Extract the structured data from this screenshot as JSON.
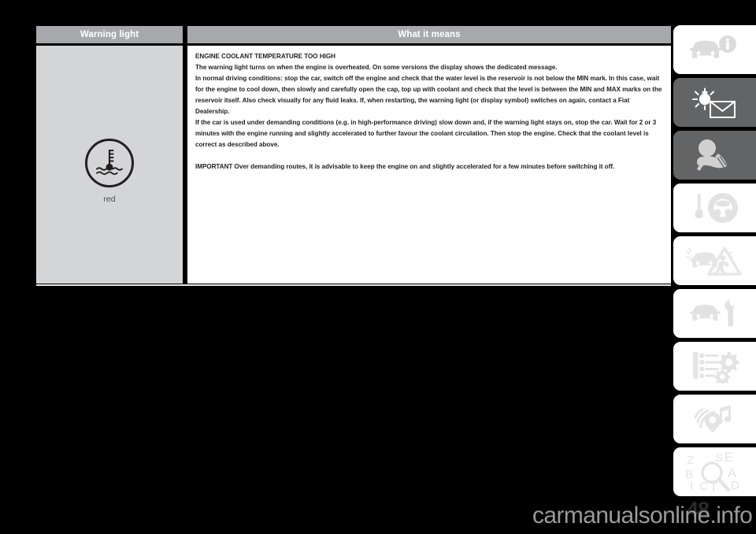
{
  "table": {
    "headers": {
      "warning_light": "Warning light",
      "what_it_means": "What it means"
    },
    "symbol": {
      "icon": "coolant-temperature-icon",
      "color_label": "red"
    },
    "content": {
      "title": "ENGINE COOLANT TEMPERATURE TOO HIGH",
      "paragraph_1": "The warning light turns on when the engine is overheated. On some versions the display shows the dedicated message.",
      "paragraph_2": "In normal driving conditions: stop the car, switch off the engine and check that the water level is the reservoir is not below the MIN mark. In this case, wait for the engine to cool down, then slowly and carefully open the cap, top up with coolant and check that the level is between the MIN and MAX marks on the reservoir itself. Also check visually for any fluid leaks. If, when restarting, the warning light (or display symbol) switches on again, contact a Fiat Dealership.",
      "paragraph_3": "If the car is used under demanding conditions (e.g. in high-performance driving) slow down and, if the warning light stays on, stop the car. Wait for 2 or 3 minutes with the engine running and slightly accelerated to further favour the coolant circulation. Then stop the engine. Check that the coolant level is correct as described above.",
      "important": "IMPORTANT Over demanding routes, it is advisable to keep the engine on and slightly accelerated for a few minutes before switching it off."
    }
  },
  "rail": {
    "tabs": [
      {
        "icon": "car-info-icon",
        "style": "light"
      },
      {
        "icon": "warning-lights-messages-icon",
        "style": "dark"
      },
      {
        "icon": "emergency-icon",
        "style": "dark"
      },
      {
        "icon": "car-startup-driving-icon",
        "style": "light"
      },
      {
        "icon": "car-accident-icon",
        "style": "light"
      },
      {
        "icon": "car-maintenance-icon",
        "style": "light"
      },
      {
        "icon": "technical-specs-icon",
        "style": "light"
      },
      {
        "icon": "multimedia-icon",
        "style": "light"
      },
      {
        "icon": "alphabetical-index-icon",
        "style": "light"
      }
    ]
  },
  "footer": {
    "page_number": "48",
    "watermark": "carmanualsonline.info"
  },
  "colors": {
    "header_bg": "#a6a8ab",
    "left_cell_bg": "#d4d5d7",
    "text": "#231f20",
    "page_bg": "#000000"
  }
}
